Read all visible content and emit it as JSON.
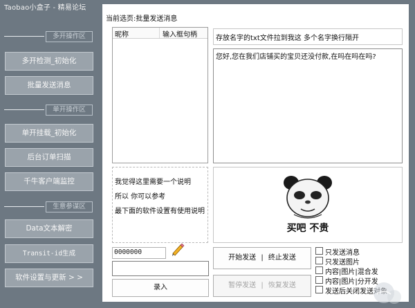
{
  "app": {
    "title": "Taobao小盒子 - 精易论坛"
  },
  "sidebar": {
    "sections": [
      "多开操作区",
      "单开操作区",
      "生意参谋区"
    ],
    "buttons": [
      "多开检测_初始化",
      "批量发送消息",
      "单开挂载_初始化",
      "后台订单扫描",
      "千牛客户端监控",
      "Data文本解密",
      "Transit-id生成",
      "软件设置与更新 > >"
    ]
  },
  "tab": {
    "title": "当前选页:批量发送消息"
  },
  "list": {
    "col1": "昵称",
    "col2": "输入框句柄"
  },
  "info": {
    "lines": [
      "我觉得这里需要一个说明",
      "所以 你可以参考",
      "最下面的软件设置有使用说明"
    ]
  },
  "hint_text": "存放名字的txt文件拉到我这 多个名字换行隔开",
  "message_text": "您好,您在我们店铺买的宝贝还没付款,在吗在吗在吗?",
  "sticker": {
    "caption": "买吧 不贵"
  },
  "handle_input": {
    "value": "0000000"
  },
  "buttons": {
    "record": "录入",
    "start_send": "开始发送",
    "stop_send": "终止发送",
    "pause_send": "暂停发送",
    "resume_send": "恢复发送",
    "separator": "|"
  },
  "options": [
    "只发送消息",
    "只发送图片",
    "内容|图片|混合发",
    "内容|图片|分开发",
    "发送后关闭发送对象"
  ],
  "colors": {
    "sidebar_bg": "#6d7882",
    "nav_button": "#9aa3ab",
    "panel_bg": "#ffffff"
  }
}
